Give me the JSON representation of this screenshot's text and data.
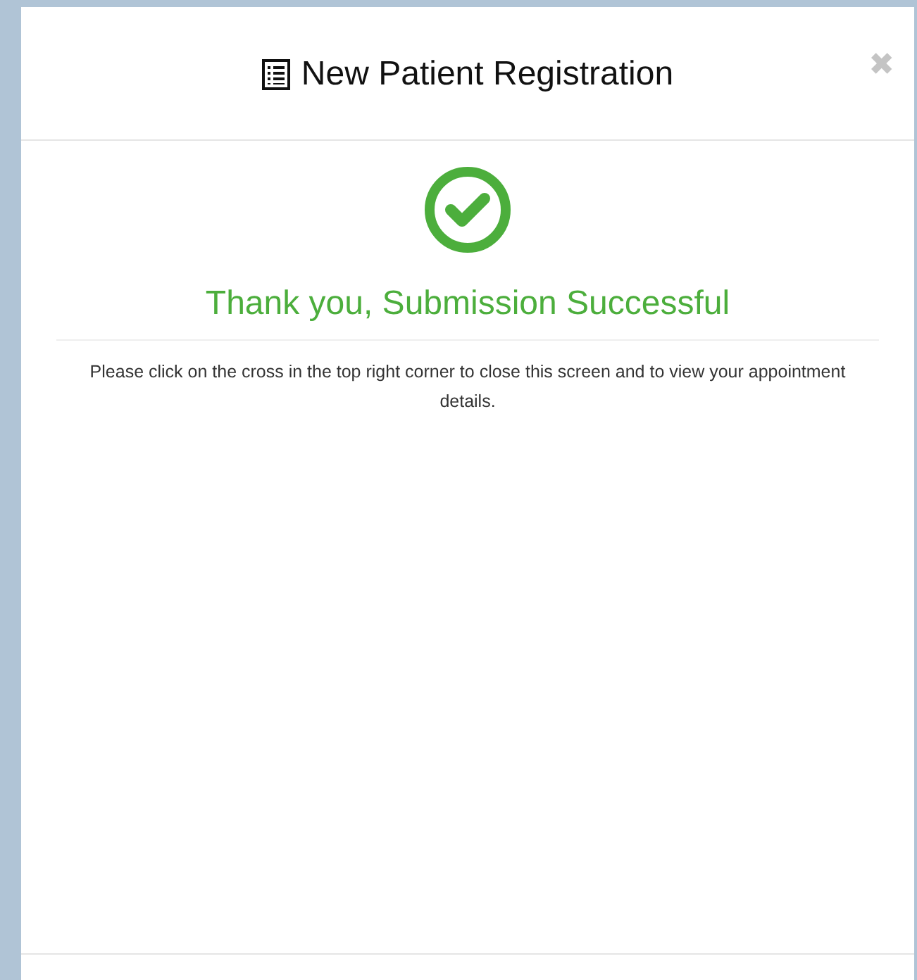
{
  "modal": {
    "title": "New Patient Registration",
    "close_symbol": "✖",
    "success": true,
    "heading": "Thank you, Submission Successful",
    "message": "Please click on the cross in the top right corner to close this screen and to view your appointment details."
  }
}
